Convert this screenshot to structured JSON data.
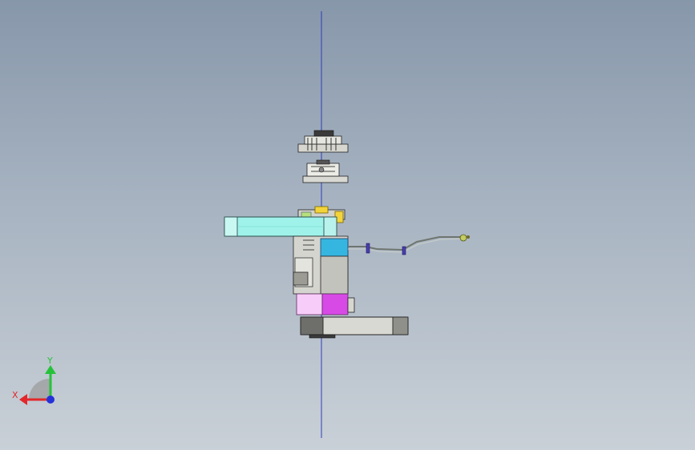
{
  "viewport": {
    "colors": {
      "bg_top": "#8797aa",
      "bg_bottom": "#c9d0d7",
      "axis_line": "#2f3db8",
      "arm_upper": "#9ff2ea",
      "motor_blue": "#35b6e0",
      "motor_magenta": "#d84ae6",
      "motor_pink": "#f8ccf8",
      "metal_light": "#d7d7d0",
      "metal_dark": "#6e6f6a",
      "yellow_part": "#f3d43a",
      "x_axis": "#e3272b",
      "y_axis": "#26c23a",
      "z_axis": "#2432d8"
    }
  },
  "triad": {
    "x_label": "X",
    "y_label": "Y"
  },
  "model": {
    "components": [
      "top-cover",
      "flange-assembly",
      "upper-arm",
      "joint-motor-housing",
      "cable-harness",
      "base-motor",
      "lower-arm"
    ]
  }
}
